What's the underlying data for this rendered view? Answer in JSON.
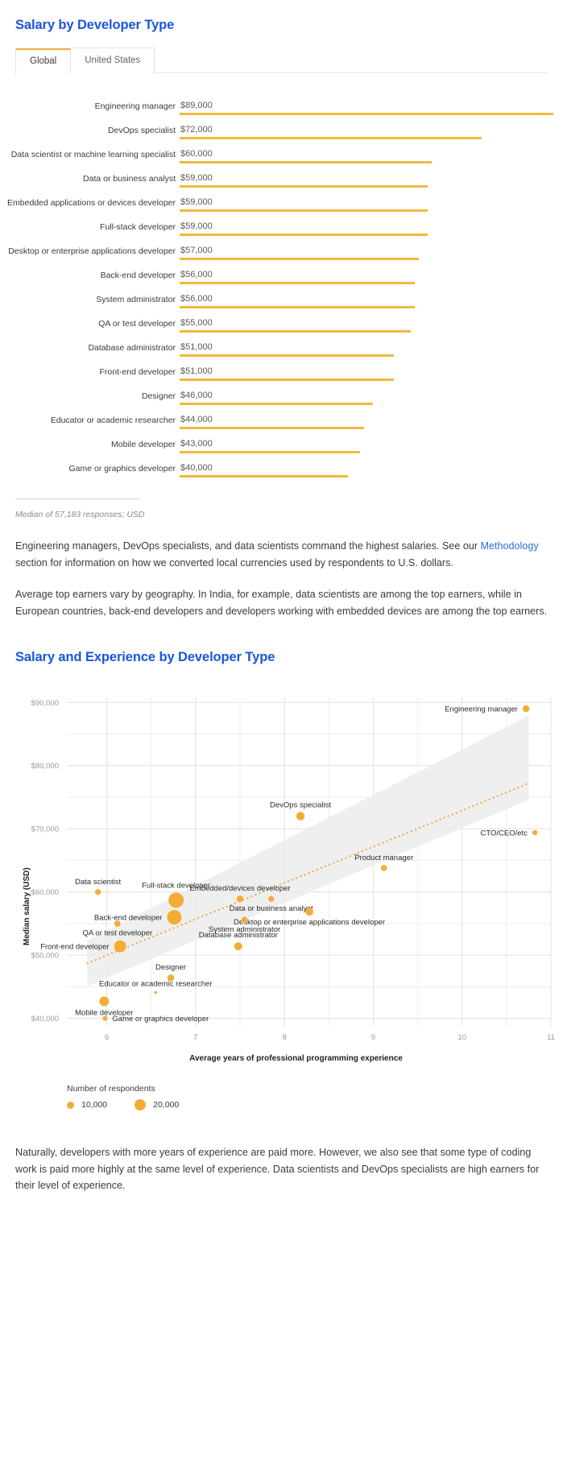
{
  "colors": {
    "heading_blue": "#1a56db",
    "bar_orange": "#f2b93f",
    "dot_orange": "#f5ac35",
    "tab_accent": "#f0ad3c",
    "link_blue": "#2a6fd6",
    "band_gray": "#ececec"
  },
  "section1": {
    "title": "Salary by Developer Type",
    "tabs": [
      {
        "label": "Global",
        "active": true
      },
      {
        "label": "United States",
        "active": false
      }
    ],
    "footnote": "Median of 57,183 responses; USD",
    "paragraphs": [
      {
        "before": "Engineering managers, DevOps specialists, and data scientists command the highest salaries. See our ",
        "link": "Methodology",
        "after": " section for information on how we converted local currencies used by respondents to U.S. dollars."
      },
      {
        "text": "Average top earners vary by geography. In India, for example, data scientists are among the top earners, while in European countries, back-end developers and developers working with embedded devices are among the top earners."
      }
    ]
  },
  "chart_data": [
    {
      "type": "bar",
      "title": "Salary by Developer Type",
      "orientation": "horizontal",
      "xlabel": "",
      "ylabel": "",
      "unit": "USD",
      "note": "Median of 57,183 responses; USD",
      "xlim": [
        0,
        89000
      ],
      "grid": false,
      "categories": [
        "Engineering manager",
        "DevOps specialist",
        "Data scientist or machine learning specialist",
        "Data or business analyst",
        "Embedded applications or devices developer",
        "Full-stack developer",
        "Desktop or enterprise applications developer",
        "Back-end developer",
        "System administrator",
        "QA or test developer",
        "Database administrator",
        "Front-end developer",
        "Designer",
        "Educator or academic researcher",
        "Mobile developer",
        "Game or graphics developer"
      ],
      "values": [
        89000,
        72000,
        60000,
        59000,
        59000,
        59000,
        57000,
        56000,
        56000,
        55000,
        51000,
        51000,
        46000,
        44000,
        43000,
        40000
      ],
      "value_labels": [
        "$89,000",
        "$72,000",
        "$60,000",
        "$59,000",
        "$59,000",
        "$59,000",
        "$57,000",
        "$56,000",
        "$56,000",
        "$55,000",
        "$51,000",
        "$51,000",
        "$46,000",
        "$44,000",
        "$43,000",
        "$40,000"
      ]
    },
    {
      "type": "scatter",
      "title": "Salary and Experience by Developer Type",
      "xlabel": "Average years of professional programming experience",
      "ylabel": "Median salary (USD)",
      "xlim": [
        5.55,
        11.0
      ],
      "ylim": [
        38800,
        90800
      ],
      "xticks": [
        6,
        7,
        8,
        9,
        10,
        11
      ],
      "xtick_labels": [
        "6",
        "7",
        "8",
        "9",
        "10",
        "11"
      ],
      "yticks": [
        40000,
        50000,
        60000,
        70000,
        80000,
        90000
      ],
      "ytick_labels": [
        "$40,000",
        "$50,000",
        "$60,000",
        "$70,000",
        "$80,000",
        "$90,000"
      ],
      "grid": true,
      "legend_position": "below-left",
      "size_legend": {
        "title": "Number of respondents",
        "entries": [
          {
            "label": "10,000",
            "value": 10000,
            "radius": 4.5
          },
          {
            "label": "20,000",
            "value": 20000,
            "radius": 7
          }
        ]
      },
      "trend": {
        "type": "dotted-line",
        "band": "confidence-band"
      },
      "points": [
        {
          "label": "Engineering manager",
          "x": 10.72,
          "y": 89000,
          "r": 4.2,
          "label_pos": "left"
        },
        {
          "label": "DevOps specialist",
          "x": 8.18,
          "y": 72000,
          "r": 5.2,
          "label_pos": "above"
        },
        {
          "label": "CTO/CEO/etc",
          "x": 10.82,
          "y": 69400,
          "r": 3.2,
          "label_pos": "left"
        },
        {
          "label": "Product manager",
          "x": 9.12,
          "y": 63800,
          "r": 3.8,
          "label_pos": "above"
        },
        {
          "label": "Data scientist",
          "x": 5.9,
          "y": 60000,
          "r": 3.6,
          "label_pos": "above"
        },
        {
          "label": "Embedded/devices developer",
          "x": 7.5,
          "y": 58900,
          "r": 4.2,
          "label_pos": "above"
        },
        {
          "label": "Full-stack developer",
          "x": 6.78,
          "y": 58700,
          "r": 9.5,
          "label_pos": "above"
        },
        {
          "label": "Data or business analyst",
          "x": 7.85,
          "y": 58900,
          "r": 3.6,
          "label_pos": "below"
        },
        {
          "label": "Back-end developer",
          "x": 6.76,
          "y": 56000,
          "r": 9.0,
          "label_pos": "left"
        },
        {
          "label": "Desktop or enterprise applications developer",
          "x": 8.28,
          "y": 56900,
          "r": 5.0,
          "label_pos": "below"
        },
        {
          "label": "QA or test developer",
          "x": 6.12,
          "y": 55000,
          "r": 3.8,
          "label_pos": "below"
        },
        {
          "label": "System administrator",
          "x": 7.55,
          "y": 55600,
          "r": 3.8,
          "label_pos": "below"
        },
        {
          "label": "Database administrator",
          "x": 7.48,
          "y": 51400,
          "r": 5.0,
          "label_pos": "above"
        },
        {
          "label": "Front-end developer",
          "x": 6.15,
          "y": 51400,
          "r": 7.5,
          "label_pos": "left"
        },
        {
          "label": "Designer",
          "x": 6.72,
          "y": 46400,
          "r": 4.2,
          "label_pos": "above"
        },
        {
          "label": "Educator or academic researcher",
          "x": 6.55,
          "y": 44100,
          "r": 1.8,
          "label_pos": "above"
        },
        {
          "label": "Mobile developer",
          "x": 5.97,
          "y": 42700,
          "r": 6.0,
          "label_pos": "below"
        },
        {
          "label": "Game or graphics developer",
          "x": 5.98,
          "y": 40000,
          "r": 3.0,
          "label_pos": "right"
        }
      ]
    }
  ],
  "section2": {
    "title": "Salary and Experience by Developer Type",
    "closing_paragraph": "Naturally, developers with more years of experience are paid more. However, we also see that some type of coding work is paid more highly at the same level of experience. Data scientists and DevOps specialists are high earners for their level of experience."
  }
}
